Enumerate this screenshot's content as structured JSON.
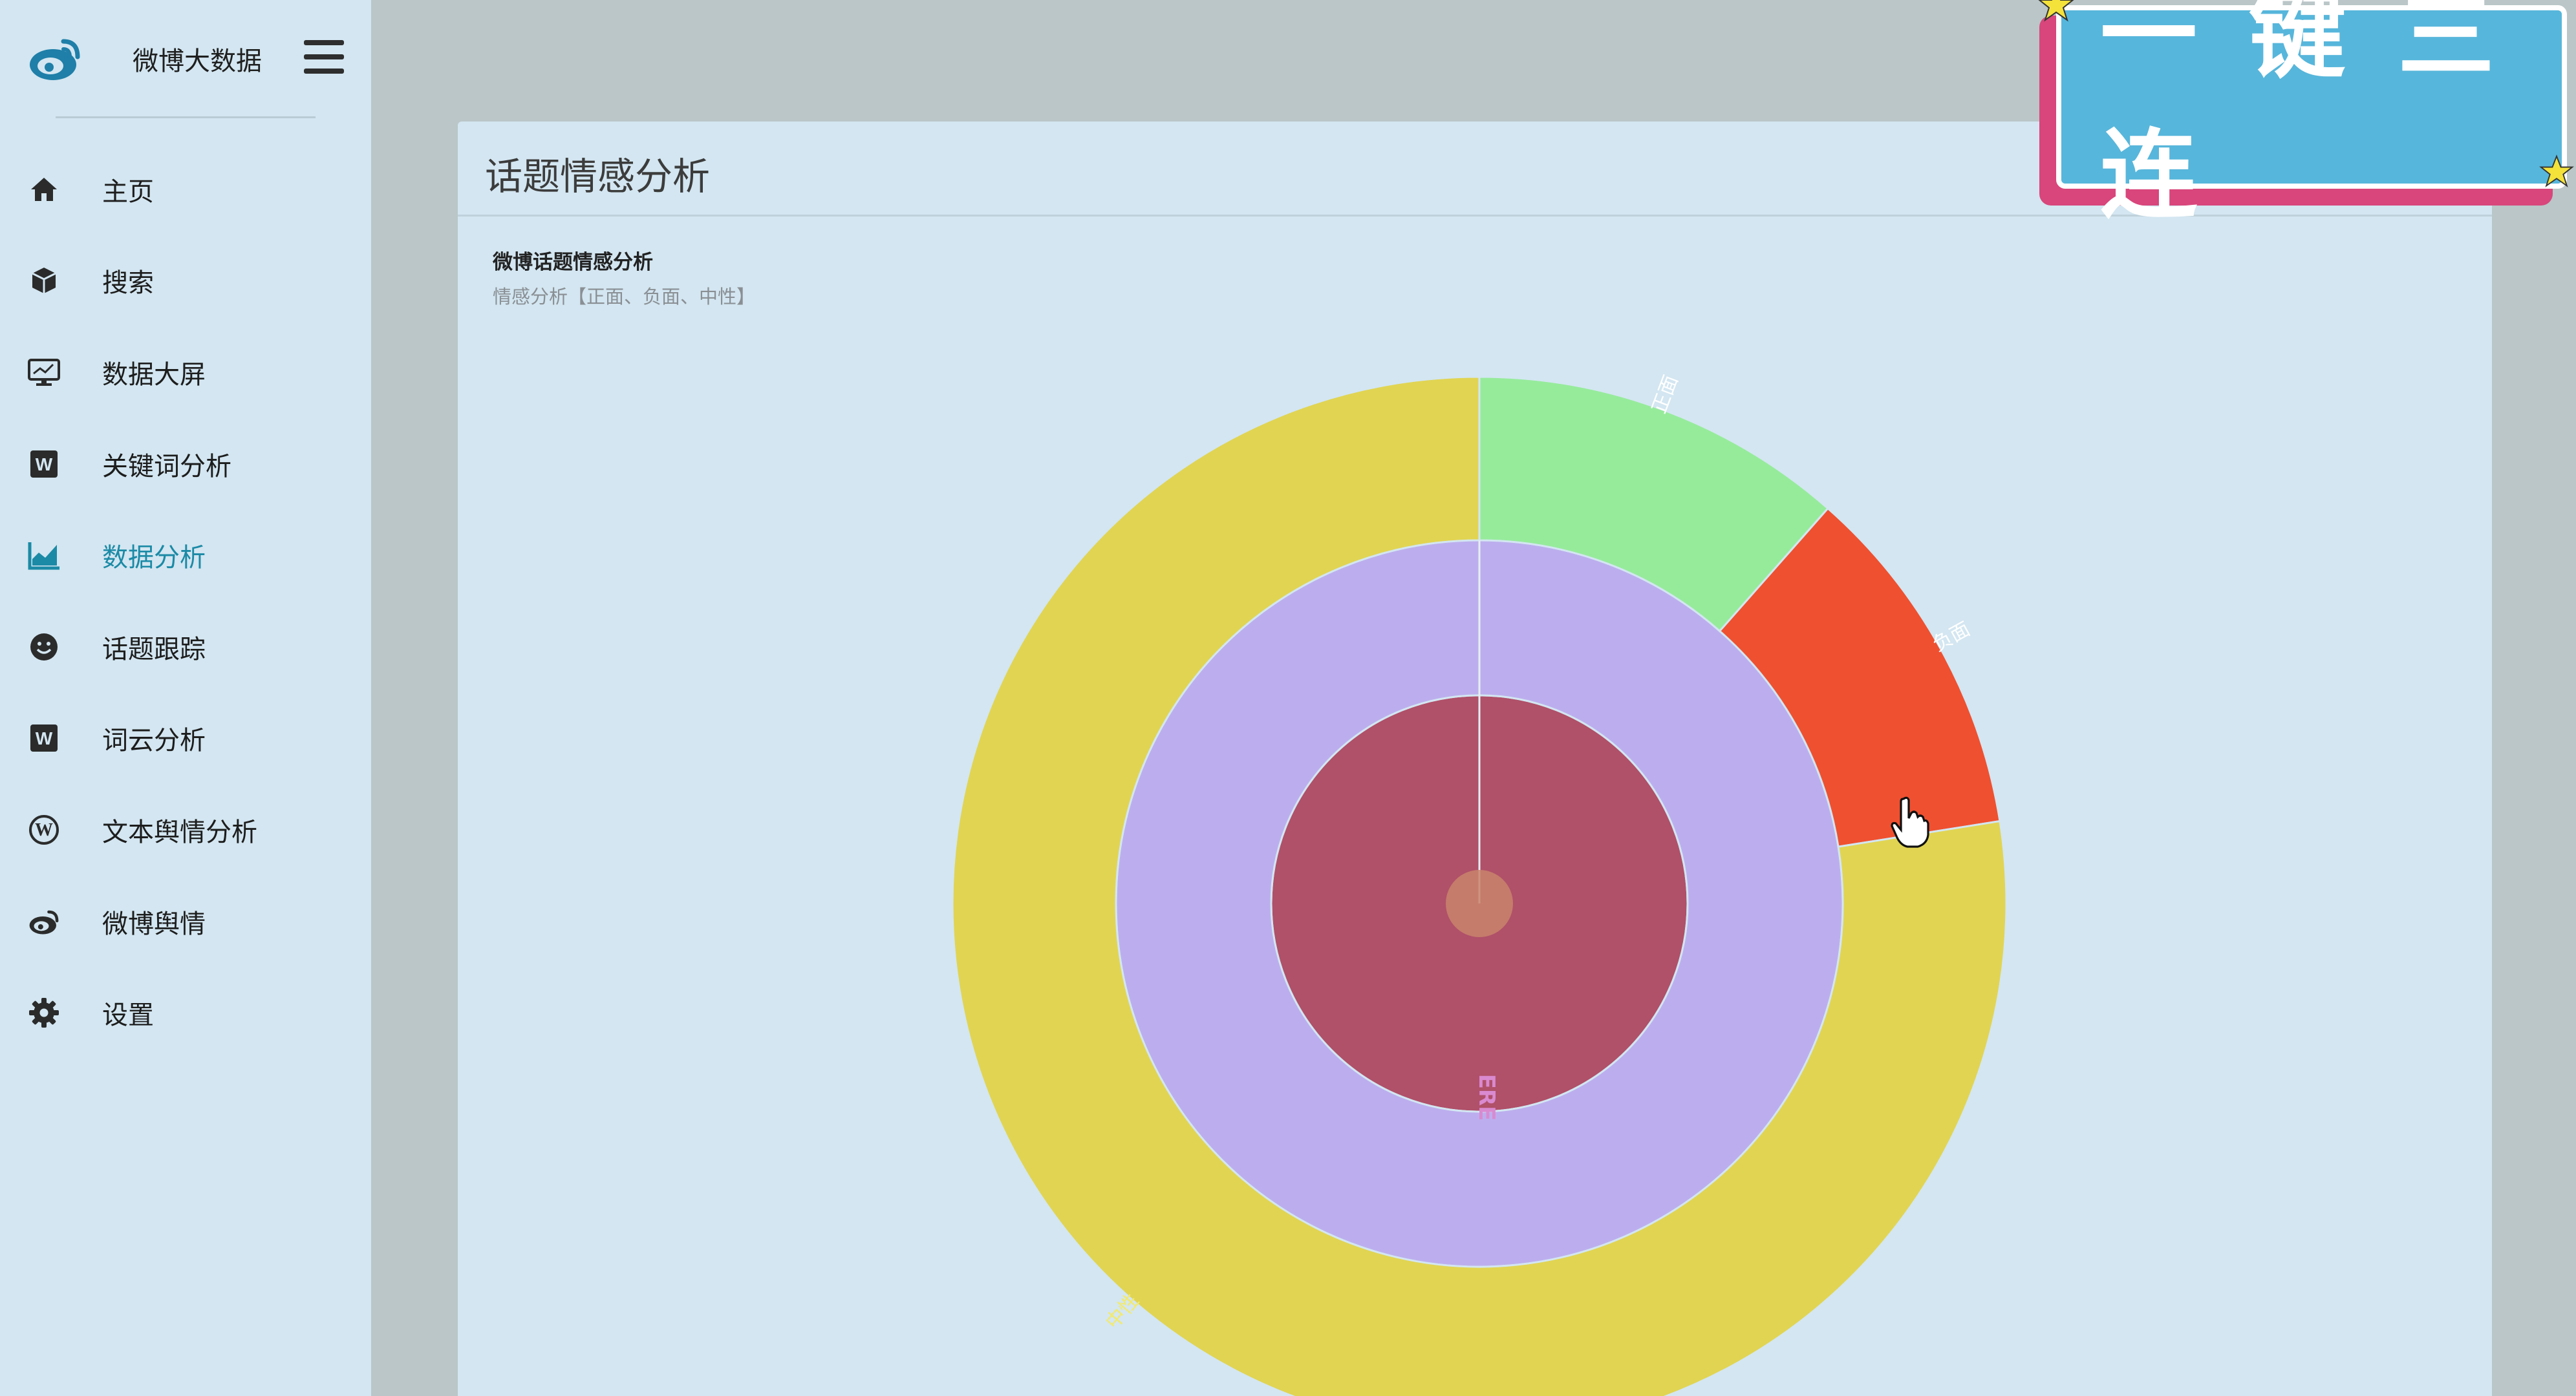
{
  "brand": {
    "title": "微博大数据",
    "logo_icon": "weibo-icon"
  },
  "nav": {
    "items": [
      {
        "label": "主页",
        "icon": "home-icon",
        "active": false
      },
      {
        "label": "搜索",
        "icon": "cube-icon",
        "active": false
      },
      {
        "label": "数据大屏",
        "icon": "monitor-icon",
        "active": false
      },
      {
        "label": "关键词分析",
        "icon": "word-icon",
        "active": false
      },
      {
        "label": "数据分析",
        "icon": "area-chart-icon",
        "active": true
      },
      {
        "label": "话题跟踪",
        "icon": "smile-icon",
        "active": false
      },
      {
        "label": "词云分析",
        "icon": "word-icon",
        "active": false
      },
      {
        "label": "文本舆情分析",
        "icon": "wordpress-icon",
        "active": false
      },
      {
        "label": "微博舆情",
        "icon": "weibo-icon",
        "active": false
      },
      {
        "label": "设置",
        "icon": "gear-icon",
        "active": false
      }
    ]
  },
  "card": {
    "title": "话题情感分析"
  },
  "badge": {
    "text": "一键三连"
  },
  "colors": {
    "accent": "#1b8aa6",
    "positive": "#96eb9b",
    "negative": "#ef5030",
    "neutral": "#e1d452",
    "middle_ring": "#bcaeee",
    "core": "#b05069"
  },
  "chart_data": {
    "type": "sunburst",
    "title": "微博话题情感分析",
    "subtitle": "情感分析【正面、负面、中性】",
    "rings": [
      {
        "level": 1,
        "segments": [
          {
            "name": "",
            "value": 1
          }
        ]
      },
      {
        "level": 2,
        "segments": [
          {
            "name": "",
            "value": 1
          }
        ]
      },
      {
        "level": 3,
        "segments": [
          {
            "name": "正面",
            "value": 0.115
          },
          {
            "name": "负面",
            "value": 0.11
          },
          {
            "name": "中性",
            "value": 0.775
          }
        ]
      }
    ],
    "center_label": "ERE"
  }
}
